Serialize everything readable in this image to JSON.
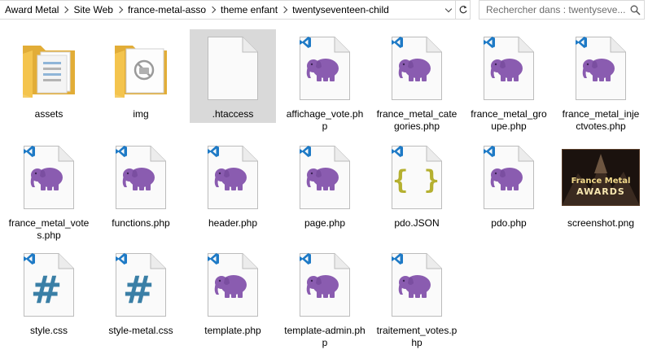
{
  "address_bar": {
    "breadcrumbs": [
      "Award Metal",
      "Site Web",
      "france-metal-asso",
      "theme enfant",
      "twentyseventeen-child"
    ]
  },
  "search": {
    "placeholder": "Rechercher dans : twentyseve..."
  },
  "files": [
    {
      "name": "assets",
      "type": "folder"
    },
    {
      "name": "img",
      "type": "folder-img"
    },
    {
      "name": ".htaccess",
      "type": "blank",
      "selected": true
    },
    {
      "name": "affichage_vote.php",
      "type": "php"
    },
    {
      "name": "france_metal_categories.php",
      "type": "php"
    },
    {
      "name": "france_metal_groupe.php",
      "type": "php"
    },
    {
      "name": "france_metal_injectvotes.php",
      "type": "php"
    },
    {
      "name": "france_metal_votes.php",
      "type": "php"
    },
    {
      "name": "functions.php",
      "type": "php"
    },
    {
      "name": "header.php",
      "type": "php"
    },
    {
      "name": "page.php",
      "type": "php"
    },
    {
      "name": "pdo.JSON",
      "type": "json"
    },
    {
      "name": "pdo.php",
      "type": "php"
    },
    {
      "name": "screenshot.png",
      "type": "image",
      "thumb_text": [
        "France Metal",
        "AWARDS"
      ]
    },
    {
      "name": "style.css",
      "type": "css"
    },
    {
      "name": "style-metal.css",
      "type": "css"
    },
    {
      "name": "template.php",
      "type": "php"
    },
    {
      "name": "template-admin.php",
      "type": "php"
    },
    {
      "name": "traitement_votes.php",
      "type": "php"
    }
  ],
  "colors": {
    "php_elephant": "#8a5cb0",
    "vscode_blue": "#1e7ac6",
    "css_hash": "#3a7fa6",
    "json_braces": "#b5b030",
    "folder": "#f3c44e",
    "selection": "#d9d9d9"
  }
}
